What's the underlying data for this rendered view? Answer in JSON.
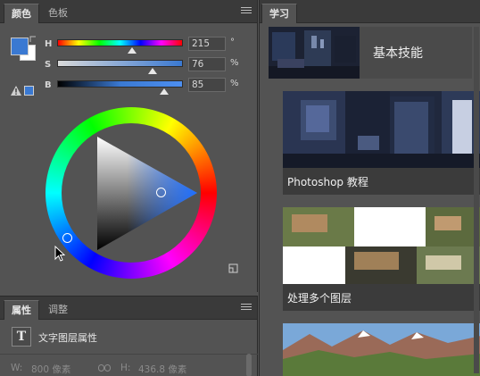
{
  "color_panel": {
    "tabs": [
      {
        "label": "颜色",
        "active": true
      },
      {
        "label": "色板",
        "active": false
      }
    ],
    "foreground_color": "#3a79d2",
    "background_color": "#ffffff",
    "web_safe_swatch_color": "#3a79d2",
    "sliders": [
      {
        "label": "H",
        "value": "215",
        "unit": "°",
        "fraction": 0.597
      },
      {
        "label": "S",
        "value": "76",
        "unit": "%",
        "fraction": 0.76
      },
      {
        "label": "B",
        "value": "85",
        "unit": "%",
        "fraction": 0.85
      }
    ],
    "icons": {
      "menu": "panel-menu-icon",
      "warning": "out-of-gamut-warning-icon",
      "cube": "color-cube-icon",
      "swap": "swap-colors-icon"
    }
  },
  "properties_panel": {
    "tabs": [
      {
        "label": "属性",
        "active": true
      },
      {
        "label": "调整",
        "active": false
      }
    ],
    "section_title": "文字图层属性",
    "type_icon_glyph": "T",
    "width_label": "W:",
    "width_value": "800 像素",
    "height_label": "H:",
    "height_value": "436.8 像素",
    "link_icon": "link-icon"
  },
  "learn_panel": {
    "tab": "学习",
    "cards": [
      {
        "label": "基本技能"
      },
      {
        "label": "Photoshop 教程"
      },
      {
        "label": "处理多个图层"
      },
      {
        "label": ""
      }
    ]
  }
}
